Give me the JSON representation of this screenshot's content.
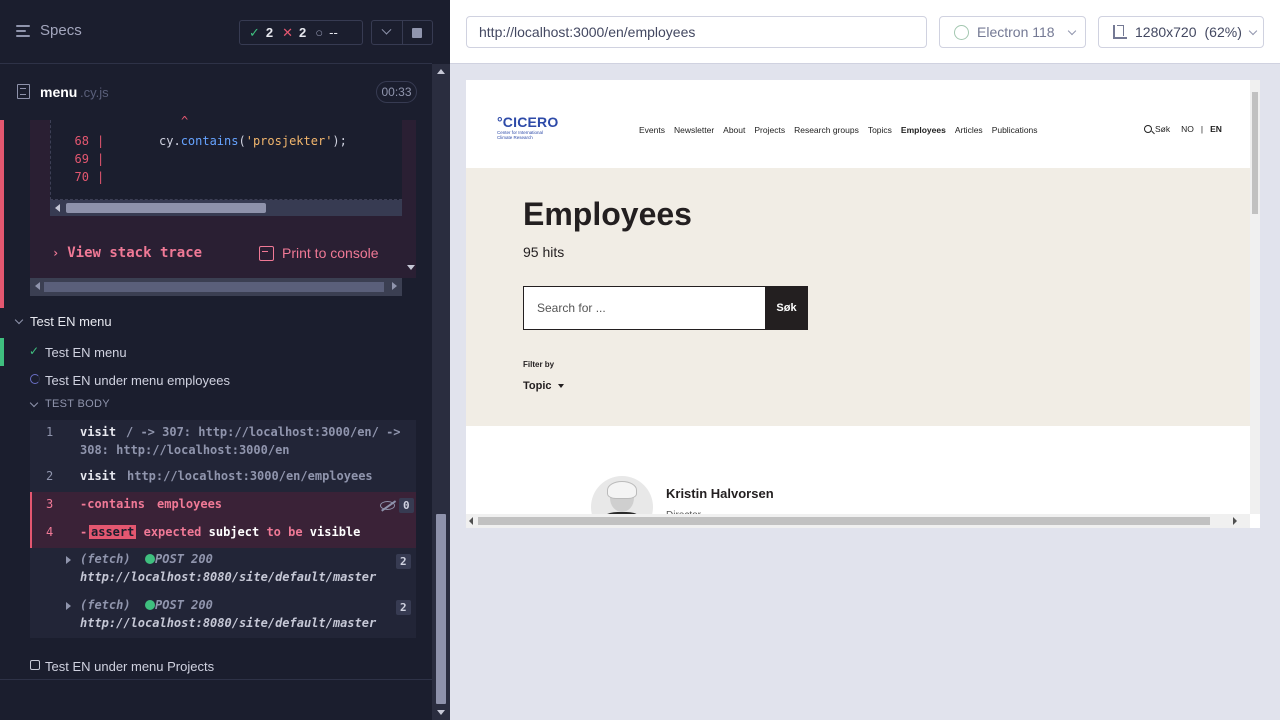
{
  "reporter": {
    "specs_label": "Specs",
    "stats": {
      "passed": "2",
      "failed": "2",
      "pending": "--"
    },
    "spec": {
      "name": "menu",
      "ext": ".cy.js",
      "duration": "00:33"
    },
    "code_frame": {
      "caret": "^",
      "lines": [
        {
          "num": "68",
          "bar": "|",
          "code_pre": "cy.",
          "code_fn": "contains",
          "code_open": "(",
          "code_str": "'prosjekter'",
          "code_close": ");"
        },
        {
          "num": "69",
          "bar": "|"
        },
        {
          "num": "70",
          "bar": "|"
        }
      ]
    },
    "view_stack_trace": "View stack trace",
    "print_to_console": "Print to console",
    "suite_title": "Test EN menu",
    "tests": [
      {
        "label": "Test EN menu",
        "state": "passed"
      },
      {
        "label": "Test EN under menu employees",
        "state": "running"
      },
      {
        "label": "Test EN under menu Projects",
        "state": "pending"
      }
    ],
    "test_body_label": "TEST BODY",
    "commands": [
      {
        "num": "1",
        "name": "visit",
        "message_line1": "/ -> 307: http://localhost:3000/en/ ->",
        "message_line2": "308: http://localhost:3000/en"
      },
      {
        "num": "2",
        "name": "visit",
        "message": "http://localhost:3000/en/employees"
      },
      {
        "num": "3",
        "name": "-contains",
        "message": "employees",
        "hidden_count": "0"
      },
      {
        "num": "4",
        "name": "-",
        "assert": "assert",
        "msg_expected": "expected",
        "msg_subject": "subject",
        "msg_to_be": "to be",
        "msg_visible": "visible"
      }
    ],
    "fetches": [
      {
        "type": "(fetch)",
        "method_status": "POST 200",
        "url": "http://localhost:8080/site/default/master",
        "count": "2"
      },
      {
        "type": "(fetch)",
        "method_status": "POST 200",
        "url": "http://localhost:8080/site/default/master",
        "count": "2"
      }
    ]
  },
  "runner": {
    "url": "http://localhost:3000/en/employees",
    "browser": "Electron 118",
    "viewport": "1280x720",
    "zoom": "(62%)"
  },
  "site": {
    "logo_main": "°CICERO",
    "logo_sub": "Center for International Climate Research",
    "nav": [
      "Events",
      "Newsletter",
      "About",
      "Projects",
      "Research groups",
      "Topics",
      "Employees",
      "Articles",
      "Publications"
    ],
    "active_nav": "Employees",
    "search_link": "Søk",
    "lang_no": "NO",
    "lang_sep": "|",
    "lang_en": "EN",
    "page_title": "Employees",
    "hits": "95 hits",
    "search_placeholder": "Search for ...",
    "search_button": "Søk",
    "filter_by": "Filter by",
    "topic_filter": "Topic",
    "person": {
      "name": "Kristin Halvorsen",
      "role": "Director"
    }
  },
  "colors": {
    "pass": "#3fbf7f",
    "fail": "#e45770",
    "accent": "#2d4aa8",
    "hero_bg": "#f1ede5"
  }
}
